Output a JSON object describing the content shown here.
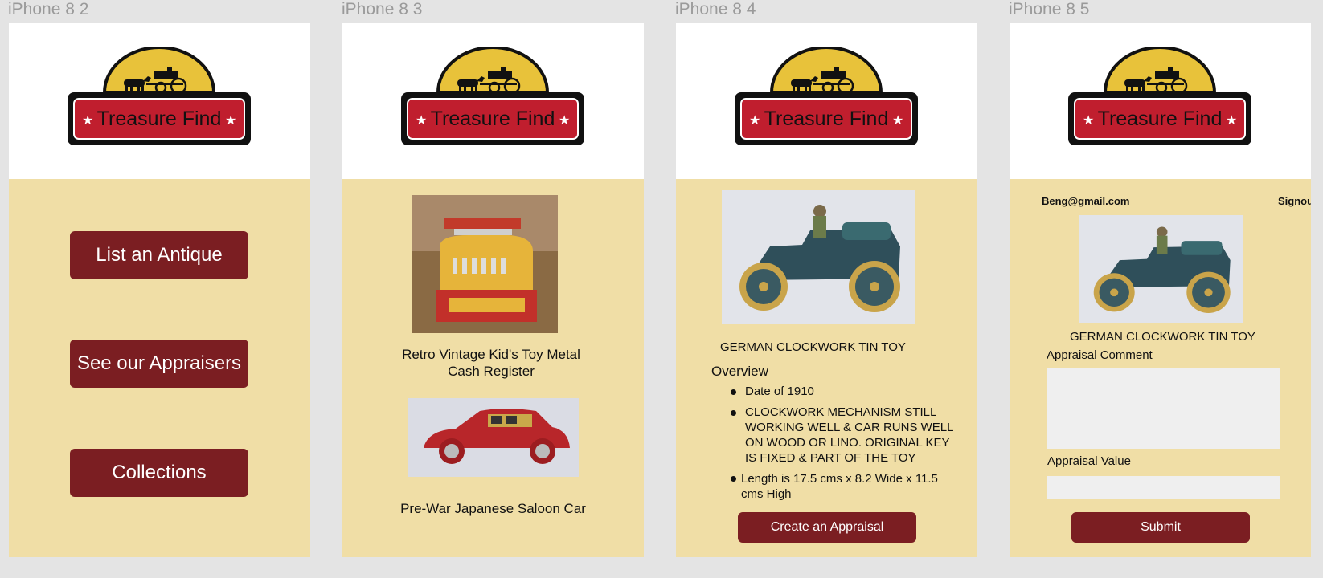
{
  "frames": [
    {
      "label": "iPhone 8 2"
    },
    {
      "label": "iPhone 8 3"
    },
    {
      "label": "iPhone 8 4"
    },
    {
      "label": "iPhone 8 5"
    }
  ],
  "brand": {
    "logo_text": "Treasure Find",
    "colors": {
      "maroon": "#7b1e22",
      "gold": "#e8c23a",
      "panel": "#f0dea6",
      "red": "#c01e2e"
    }
  },
  "home": {
    "buttons": [
      "List an Antique",
      "See our Appraisers",
      "Collections"
    ]
  },
  "listing": {
    "items": [
      {
        "title": "Retro Vintage Kid's Toy Metal Cash Register"
      },
      {
        "title": "Pre-War Japanese Saloon Car"
      }
    ]
  },
  "detail": {
    "title": "GERMAN CLOCKWORK TIN TOY",
    "overview_heading": "Overview",
    "bullets": [
      "Date of 1910",
      "CLOCKWORK MECHANISM STILL WORKING WELL & CAR RUNS WELL ON WOOD OR LINO.  ORIGINAL KEY IS FIXED & PART OF THE TOY",
      "Length is 17.5 cms x 8.2 Wide x 11.5 cms High"
    ],
    "cta": "Create an Appraisal"
  },
  "appraisal": {
    "user_email": "Beng@gmail.com",
    "signout": "Signout",
    "title": "GERMAN CLOCKWORK TIN TOY",
    "comment_label": "Appraisal Comment",
    "comment_value": "",
    "value_label": "Appraisal Value",
    "value_value": "",
    "submit": "Submit"
  }
}
